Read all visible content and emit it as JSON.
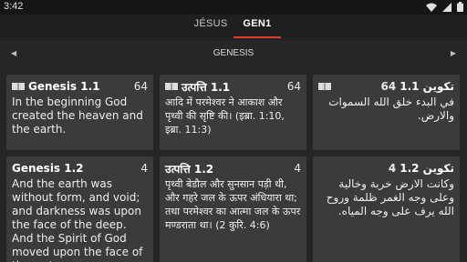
{
  "status": {
    "time": "3:42"
  },
  "tabs": [
    {
      "label": "JÉSUS",
      "active": false
    },
    {
      "label": "GEN1",
      "active": true
    }
  ],
  "book": {
    "name": "GENESIS",
    "prev_icon": "triangle-left-icon",
    "next_icon": "triangle-right-icon"
  },
  "cards": [
    {
      "ref": "Genesis 1.1",
      "num": "64",
      "text": "In the beginning God created the heaven and the earth.",
      "icon": "book-icon"
    },
    {
      "ref": "उत्पत्ति 1.1",
      "num": "64",
      "text": "आदि में परमेश्वर ने आकाश और पृथ्वी की सृष्टि की। (इब्रा. 1:10, इब्रा. 11:3)",
      "icon": "book-icon"
    },
    {
      "ref": "تكوين 1.1",
      "num": "64",
      "text": "في البدء خلق الله السموات والارض.",
      "icon": "book-icon"
    },
    {
      "ref": "Genesis 1.2",
      "num": "4",
      "text": "And the earth was without form, and void; and darkness was upon the face of the deep. And the Spirit of God moved upon the face of the waters."
    },
    {
      "ref": "उत्पत्ति 1.2",
      "num": "4",
      "text": "पृथ्वी बेडौल और सुनसान पड़ी थी, और गहरे जल के ऊपर अंधियारा था; तथा परमेश्वर का आत्मा जल के ऊपर मण्डराता था। (2 कुरि. 4:6)"
    },
    {
      "ref": "تكوين 1.2",
      "num": "4",
      "text": "وكانت الارض خربة وخالية وعلى وجه الغمر ظلمة وروح الله يرف على وجه المياه."
    }
  ],
  "colors": {
    "accent": "#e53935",
    "card": "#3b3b3b",
    "background": "#262626"
  }
}
